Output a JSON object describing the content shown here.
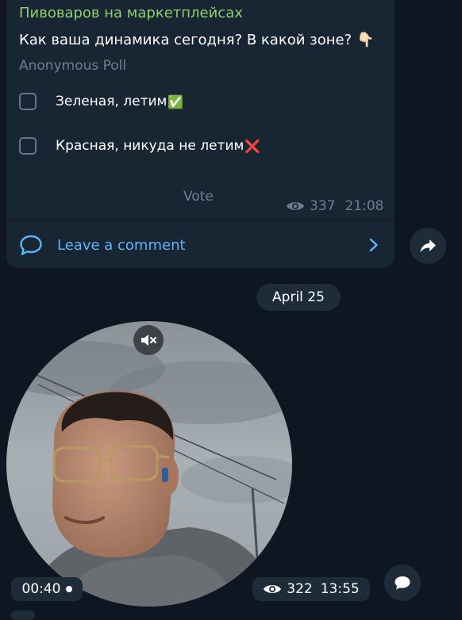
{
  "poll": {
    "channel": "Пивоваров на маркетплейсах",
    "question": "Как ваша динамика сегодня? В какой зоне?",
    "question_emoji": "👇🏻",
    "type": "Anonymous Poll",
    "options": [
      {
        "label": "Зеленая, летим",
        "mark": "✅"
      },
      {
        "label": "Красная, никуда не летим",
        "mark": "❌"
      }
    ],
    "vote_label": "Vote",
    "views": "337",
    "time": "21:08",
    "comment_label": "Leave a comment"
  },
  "date_separator": "April 25",
  "video": {
    "duration": "00:40",
    "views": "322",
    "time": "13:55"
  },
  "colors": {
    "background": "#0e1621",
    "bubble": "#182533",
    "channel_name": "#8fd06f",
    "link": "#5eb5f7",
    "muted_text": "#6d7f8f"
  },
  "icons": [
    "eye-icon",
    "comment-icon",
    "chevron-right-icon",
    "share-icon",
    "mute-icon",
    "reply-icon"
  ]
}
